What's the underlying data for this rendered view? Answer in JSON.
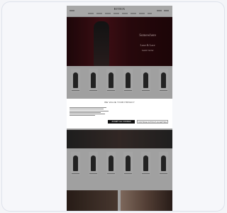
{
  "site": {
    "logo": "BITRIX",
    "colors": {
      "hero_bg": "#2b0a0e",
      "accent_button": "#111111",
      "page_bg": "#f4f5f8"
    }
  },
  "hero": {
    "line1": "Somewhere",
    "line2": "Luxe & Lace",
    "line3": "SHOP NOW"
  },
  "consent": {
    "title": "WE VALUE YOUR PRIVACY",
    "accept_label": "ACCEPT ALL COOKIES",
    "reject_label": "CONTINUE WITHOUT ACCEPTING"
  }
}
